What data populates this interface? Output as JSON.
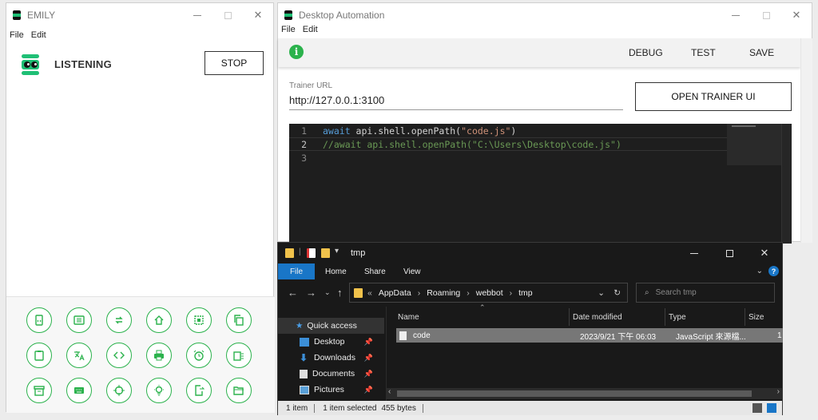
{
  "emily": {
    "title": "EMILY",
    "menu": [
      "File",
      "Edit"
    ],
    "status": "LISTENING",
    "stop_label": "STOP",
    "tool_icons": [
      "file-code-icon",
      "list-alt-icon",
      "loop-icon",
      "home-icon",
      "select-region-icon",
      "copy-icon",
      "clipboard-icon",
      "translate-icon",
      "code-icon",
      "printer-icon",
      "alarm-icon",
      "file-list-icon",
      "archive-icon",
      "keyboard-icon",
      "crosshair-icon",
      "lightbulb-icon",
      "file-export-icon",
      "folder-open-icon"
    ]
  },
  "automation": {
    "title": "Desktop Automation",
    "menu": [
      "File",
      "Edit"
    ],
    "toolbar": {
      "debug": "DEBUG",
      "test": "TEST",
      "save": "SAVE"
    },
    "trainer_label": "Trainer URL",
    "trainer_url": "http://127.0.0.1:3100",
    "open_trainer": "OPEN TRAINER UI",
    "code_lines": [
      {
        "n": "1",
        "kw": "await",
        "text": " api.shell.openPath(",
        "str": "\"code.js\"",
        "end": ")"
      },
      {
        "n": "2",
        "comment": "//await api.shell.openPath(\"C:\\Users\\Desktop\\code.js\")"
      },
      {
        "n": "3"
      }
    ]
  },
  "explorer": {
    "title": "tmp",
    "tabs": [
      "File",
      "Home",
      "Share",
      "View"
    ],
    "path": [
      "«",
      "AppData",
      "Roaming",
      "webbot",
      "tmp"
    ],
    "search_placeholder": "Search tmp",
    "nav_items": [
      {
        "label": "Quick access",
        "icon": "star-icon"
      },
      {
        "label": "Desktop",
        "icon": "desktop-icon"
      },
      {
        "label": "Downloads",
        "icon": "download-icon"
      },
      {
        "label": "Documents",
        "icon": "documents-icon"
      },
      {
        "label": "Pictures",
        "icon": "pictures-icon"
      }
    ],
    "columns": [
      "Name",
      "Date modified",
      "Type",
      "Size"
    ],
    "files": [
      {
        "name": "code",
        "date": "2023/9/21 下午 06:03",
        "type": "JavaScript 來源檔...",
        "size": "1"
      }
    ],
    "status": {
      "items": "1 item",
      "selected": "1 item selected",
      "size": "455 bytes"
    }
  }
}
